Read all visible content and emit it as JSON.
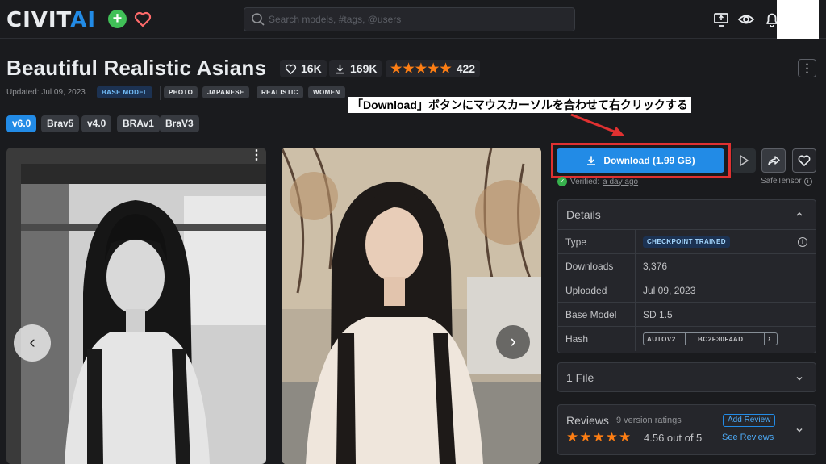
{
  "header": {
    "logo_text": "CIVIT",
    "logo_accent": "AI",
    "search_placeholder": "Search models, #tags, @users",
    "accent_color": "#228be6"
  },
  "model": {
    "title": "Beautiful Realistic Asians",
    "likes": "16K",
    "downloads": "169K",
    "rating_stars": "★★★★★",
    "rating_count": "422",
    "updated": "Updated: Jul 09, 2023",
    "tags": [
      "BASE MODEL",
      "PHOTO",
      "JAPANESE",
      "REALISTIC",
      "WOMEN"
    ],
    "more_label": "⋮"
  },
  "annotation": {
    "text": "「Download」ボタンにマウスカーソルを合わせて右クリックする",
    "highlight_color": "#e03131"
  },
  "versions": [
    "v6.0",
    "Brav5",
    "v4.0",
    "BRAv1",
    "BraV3"
  ],
  "gallery": {
    "prev": "‹",
    "next": "›",
    "menu": "⋮"
  },
  "actions": {
    "download_label": "Download (1.99 GB)",
    "verified_label": "Verified:",
    "verified_when": "a day ago",
    "format": "SafeTensor"
  },
  "details": {
    "title": "Details",
    "rows": [
      {
        "label": "Type",
        "value": "CHECKPOINT TRAINED"
      },
      {
        "label": "Downloads",
        "value": "3,376"
      },
      {
        "label": "Uploaded",
        "value": "Jul 09, 2023"
      },
      {
        "label": "Base Model",
        "value": "SD 1.5"
      },
      {
        "label": "Hash",
        "value": ""
      }
    ],
    "hash_type": "AUTOV2",
    "hash_value": "BC2F30F4AD",
    "hash_more": "›"
  },
  "files": {
    "title": "1 File"
  },
  "reviews": {
    "title": "Reviews",
    "count_text": "9 version ratings",
    "stars": "★★★★★",
    "score_text": "4.56 out of 5",
    "add_label": "Add Review",
    "see_label": "See Reviews"
  }
}
